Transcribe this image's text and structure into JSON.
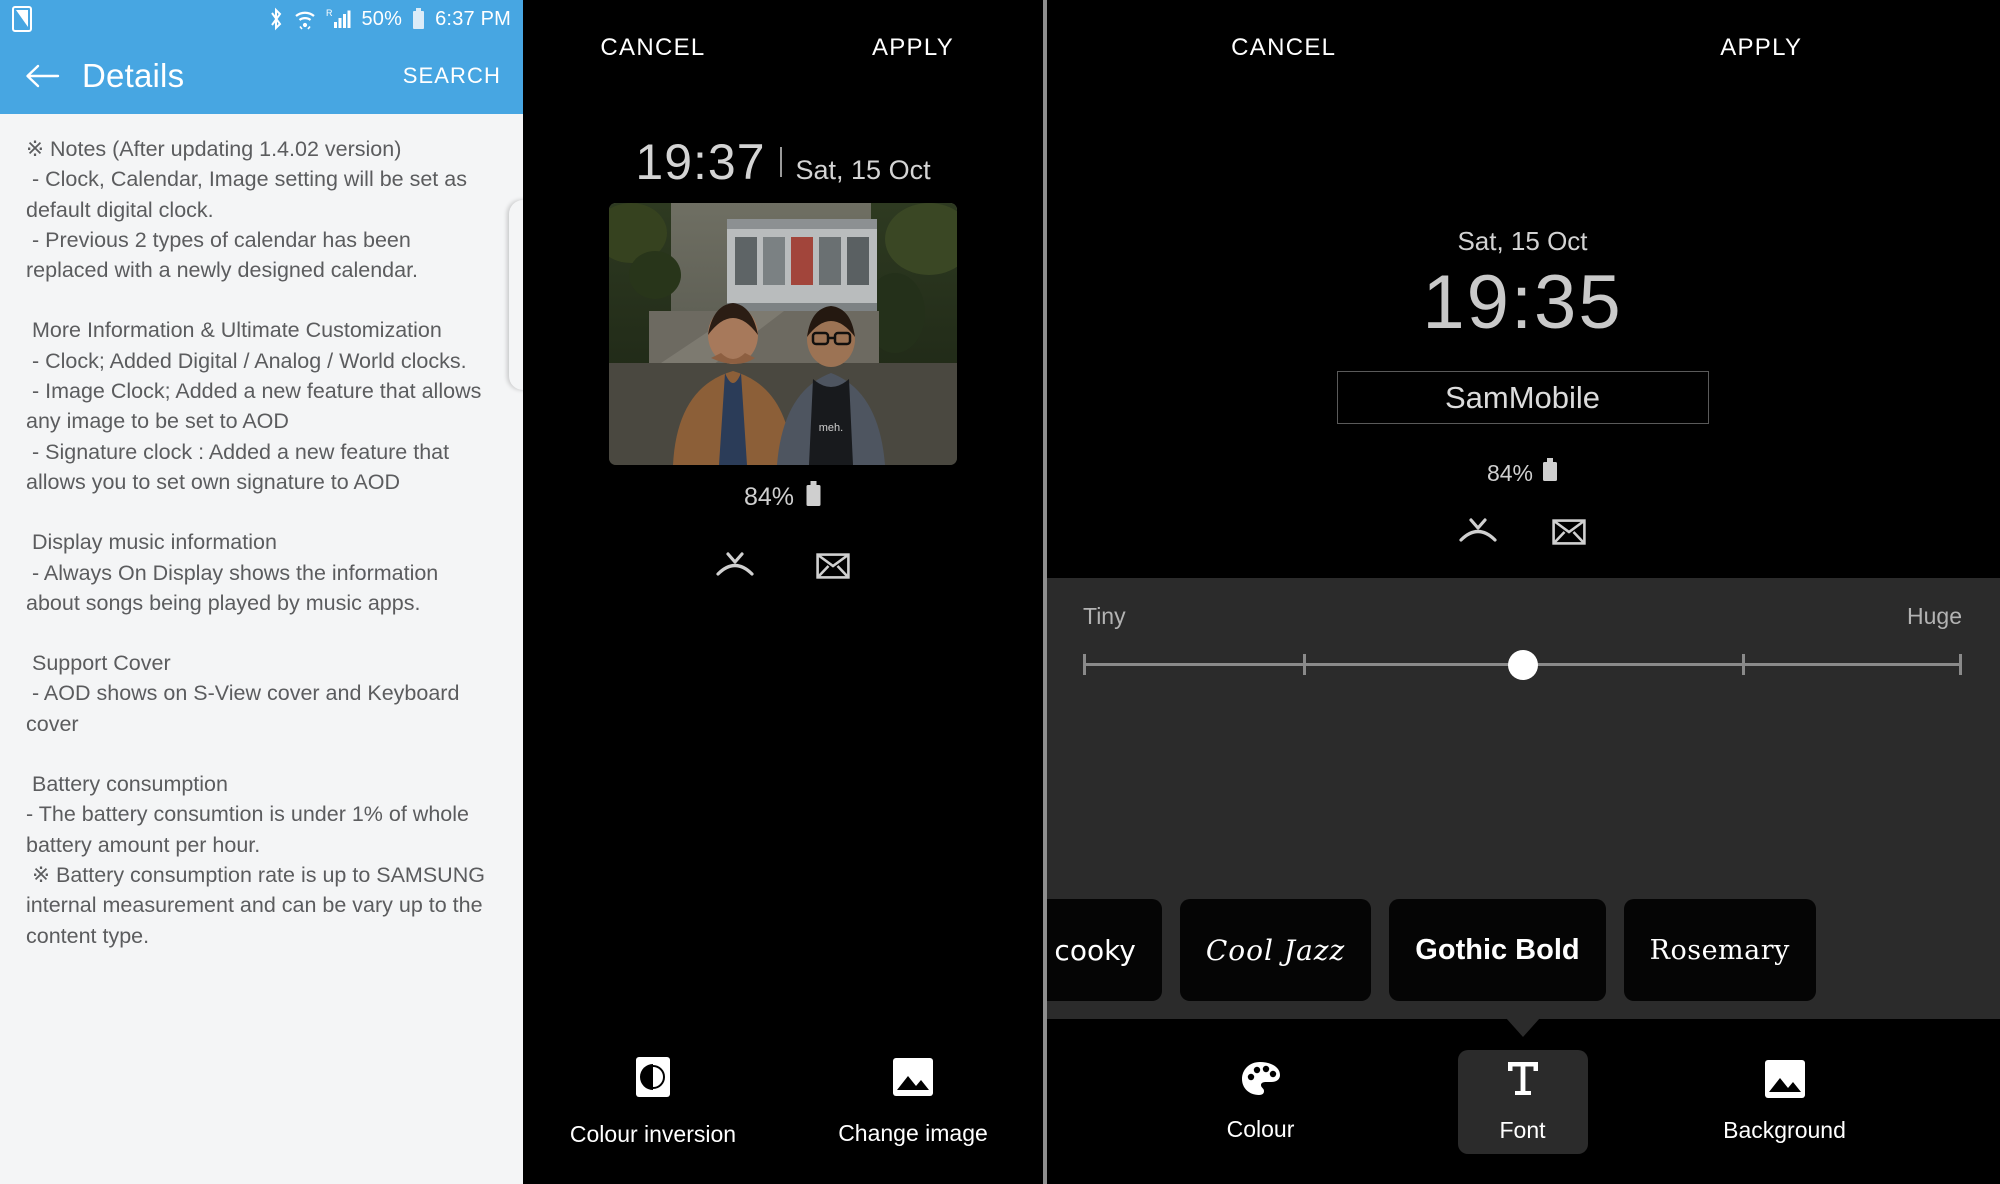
{
  "left_panel": {
    "status_bar": {
      "app_icon": "note-app-icon",
      "bluetooth": "bluetooth-icon",
      "wifi": "wifi-icon",
      "roaming_signal": "signal-roaming-icon",
      "battery_percent": "50%",
      "battery": "battery-icon",
      "clock": "6:37 PM"
    },
    "app_bar": {
      "back": "back-arrow-icon",
      "title": "Details",
      "search_label": "SEARCH"
    },
    "body": {
      "paragraphs": [
        "※ Notes (After updating 1.4.02 version)\n - Clock, Calendar, Image setting will be set as default digital clock.\n - Previous 2 types of calendar has been replaced with a newly designed calendar.",
        " More Information & Ultimate Customization\n - Clock; Added Digital / Analog / World clocks.\n - Image Clock; Added a new feature that allows any image to be set to AOD\n - Signature clock : Added a new feature that allows you to set own signature to AOD",
        " Display music information\n - Always On Display shows the information about songs being played by music apps.",
        " Support Cover\n - AOD shows on S-View cover and Keyboard cover",
        " Battery consumption\n- The battery consumtion is under 1% of whole battery amount per hour.\n ※ Battery consumption rate is up to SAMSUNG internal measurement and can be vary up to the content type."
      ]
    }
  },
  "middle_panel": {
    "header": {
      "cancel_label": "CANCEL",
      "apply_label": "APPLY"
    },
    "preview": {
      "time": "19:37",
      "date": "Sat, 15 Oct",
      "battery_percent": "84%",
      "battery_icon": "battery-icon",
      "notification_icons": [
        "missed-call-icon",
        "envelope-icon"
      ],
      "image_alt": "two-people-selfie-photo"
    },
    "tools": [
      {
        "icon": "colour-inversion-icon",
        "label": "Colour inversion"
      },
      {
        "icon": "change-image-icon",
        "label": "Change image"
      }
    ]
  },
  "right_panel": {
    "header": {
      "cancel_label": "CANCEL",
      "apply_label": "APPLY"
    },
    "preview": {
      "date": "Sat, 15 Oct",
      "time": "19:35",
      "signature_text": "SamMobile",
      "battery_percent": "84%",
      "battery_icon": "battery-icon",
      "notification_icons": [
        "missed-call-icon",
        "envelope-icon"
      ]
    },
    "font_size_slider": {
      "min_label": "Tiny",
      "max_label": "Huge",
      "steps": 5,
      "value": 3,
      "thumb_percent": 50
    },
    "font_chips": [
      {
        "label": "co cooky",
        "style": "cooky",
        "truncated": true
      },
      {
        "label": "Cool Jazz",
        "style": "jazz",
        "truncated": false
      },
      {
        "label": "Gothic Bold",
        "style": "gothic",
        "truncated": false
      },
      {
        "label": "Rosemary",
        "style": "rose",
        "truncated": false
      }
    ],
    "tabs": [
      {
        "icon": "palette-icon",
        "label": "Colour",
        "active": false
      },
      {
        "icon": "text-format-icon",
        "label": "Font",
        "active": true
      },
      {
        "icon": "background-image-icon",
        "label": "Background",
        "active": false
      }
    ]
  },
  "colors": {
    "accent_blue": "#47a6e2",
    "page_bg": "#f4f5f6",
    "body_text": "#5b5c5e",
    "aod_bg": "#000000",
    "panel_bg": "#2b2b2b",
    "preview_text": "#cfcfcf"
  }
}
